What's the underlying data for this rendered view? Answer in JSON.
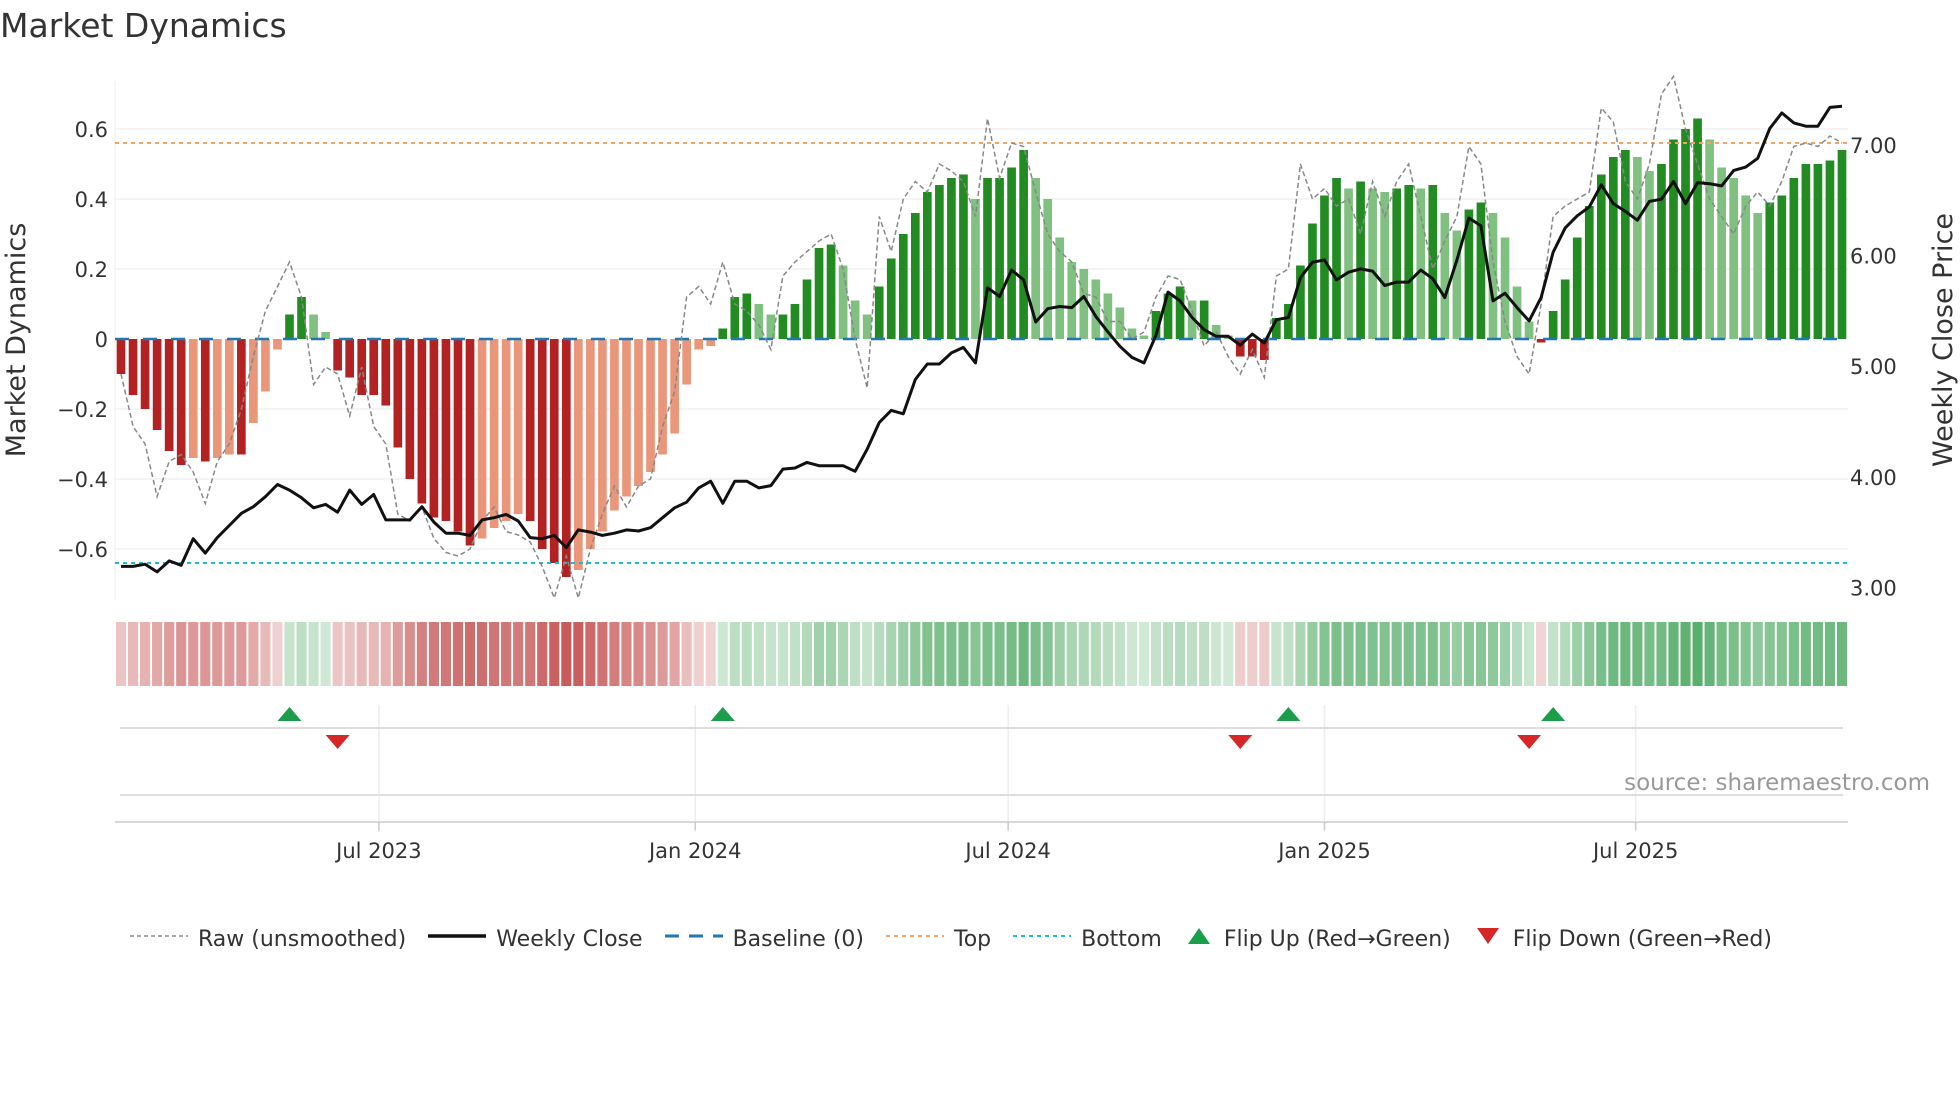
{
  "title": "Market Dynamics",
  "source": "source: sharemaestro.com",
  "chart_data": {
    "type": "bar",
    "title": "Market Dynamics",
    "ylabel": "Market Dynamics",
    "y2label": "Weekly Close Price",
    "start_week": "2023-02-01",
    "frequency": "weekly",
    "ylim": [
      -0.75,
      0.75
    ],
    "y2lim": [
      2.9,
      7.6
    ],
    "yticks": [
      0.6,
      0.4,
      0.2,
      0,
      -0.2,
      -0.4,
      -0.6
    ],
    "ytick_labels": [
      "0.6",
      "0.4",
      "0.2",
      "0",
      "−0.2",
      "−0.4",
      "−0.6"
    ],
    "y2ticks": [
      7,
      6,
      5,
      4,
      3
    ],
    "y2tick_labels": [
      "7.00",
      "6.00",
      "5.00",
      "4.00",
      "3.00"
    ],
    "xticks": [
      {
        "date": "2023-07-01",
        "label": "Jul 2023"
      },
      {
        "date": "2024-01-01",
        "label": "Jan 2024"
      },
      {
        "date": "2024-07-01",
        "label": "Jul 2024"
      },
      {
        "date": "2025-01-01",
        "label": "Jan 2025"
      },
      {
        "date": "2025-07-01",
        "label": "Jul 2025"
      }
    ],
    "top": 0.56,
    "bottom": -0.64,
    "baseline": 0,
    "smoothed": [
      -0.1,
      -0.16,
      -0.2,
      -0.26,
      -0.32,
      -0.36,
      -0.34,
      -0.35,
      -0.34,
      -0.33,
      -0.33,
      -0.24,
      -0.15,
      -0.03,
      0.07,
      0.12,
      0.07,
      0.02,
      -0.09,
      -0.11,
      -0.16,
      -0.16,
      -0.19,
      -0.31,
      -0.4,
      -0.47,
      -0.51,
      -0.52,
      -0.55,
      -0.59,
      -0.57,
      -0.54,
      -0.52,
      -0.5,
      -0.52,
      -0.6,
      -0.64,
      -0.68,
      -0.66,
      -0.6,
      -0.55,
      -0.49,
      -0.45,
      -0.42,
      -0.38,
      -0.33,
      -0.27,
      -0.13,
      -0.03,
      -0.02,
      0.03,
      0.12,
      0.13,
      0.1,
      0.07,
      0.07,
      0.1,
      0.17,
      0.26,
      0.27,
      0.21,
      0.11,
      0.07,
      0.15,
      0.23,
      0.3,
      0.36,
      0.42,
      0.44,
      0.46,
      0.47,
      0.4,
      0.46,
      0.46,
      0.49,
      0.54,
      0.46,
      0.4,
      0.29,
      0.22,
      0.2,
      0.17,
      0.13,
      0.09,
      0.03,
      0.01,
      0.08,
      0.13,
      0.15,
      0.11,
      0.11,
      0.04,
      0.01,
      -0.05,
      -0.05,
      -0.06,
      0.06,
      0.1,
      0.21,
      0.33,
      0.41,
      0.46,
      0.43,
      0.45,
      0.43,
      0.42,
      0.43,
      0.44,
      0.43,
      0.44,
      0.36,
      0.31,
      0.37,
      0.39,
      0.36,
      0.29,
      0.15,
      0.05,
      -0.01,
      0.08,
      0.17,
      0.29,
      0.38,
      0.47,
      0.52,
      0.54,
      0.52,
      0.48,
      0.5,
      0.57,
      0.6,
      0.63,
      0.57,
      0.49,
      0.46,
      0.41,
      0.36,
      0.39,
      0.41,
      0.46,
      0.5,
      0.5,
      0.51,
      0.54
    ],
    "raw": [
      -0.1,
      -0.25,
      -0.3,
      -0.45,
      -0.35,
      -0.33,
      -0.38,
      -0.47,
      -0.35,
      -0.3,
      -0.2,
      -0.05,
      0.08,
      0.15,
      0.22,
      0.12,
      -0.13,
      -0.08,
      -0.1,
      -0.22,
      -0.08,
      -0.25,
      -0.3,
      -0.5,
      -0.52,
      -0.48,
      -0.57,
      -0.61,
      -0.62,
      -0.6,
      -0.52,
      -0.48,
      -0.55,
      -0.56,
      -0.58,
      -0.65,
      -0.74,
      -0.62,
      -0.74,
      -0.6,
      -0.5,
      -0.42,
      -0.48,
      -0.42,
      -0.4,
      -0.25,
      -0.15,
      0.12,
      0.15,
      0.1,
      0.22,
      0.1,
      0.08,
      0.04,
      -0.03,
      0.18,
      0.22,
      0.25,
      0.28,
      0.3,
      0.2,
      0.0,
      -0.14,
      0.35,
      0.25,
      0.4,
      0.45,
      0.42,
      0.5,
      0.48,
      0.45,
      0.35,
      0.63,
      0.46,
      0.56,
      0.55,
      0.42,
      0.3,
      0.25,
      0.22,
      0.13,
      0.12,
      0.05,
      0.05,
      0.0,
      0.02,
      0.12,
      0.18,
      0.17,
      0.08,
      -0.02,
      0.02,
      -0.05,
      -0.1,
      -0.03,
      -0.11,
      0.18,
      0.2,
      0.5,
      0.4,
      0.43,
      0.38,
      0.4,
      0.3,
      0.45,
      0.35,
      0.45,
      0.5,
      0.35,
      0.2,
      0.28,
      0.35,
      0.55,
      0.5,
      0.22,
      0.05,
      -0.05,
      -0.1,
      0.1,
      0.35,
      0.38,
      0.4,
      0.42,
      0.66,
      0.62,
      0.45,
      0.4,
      0.5,
      0.7,
      0.75,
      0.6,
      0.5,
      0.4,
      0.35,
      0.3,
      0.38,
      0.42,
      0.38,
      0.45,
      0.55,
      0.56,
      0.55,
      0.58,
      0.56
    ],
    "close": [
      3.19,
      3.19,
      3.21,
      3.14,
      3.24,
      3.2,
      3.44,
      3.31,
      3.45,
      3.56,
      3.67,
      3.73,
      3.82,
      3.93,
      3.88,
      3.81,
      3.72,
      3.75,
      3.68,
      3.88,
      3.75,
      3.84,
      3.61,
      3.61,
      3.61,
      3.73,
      3.59,
      3.49,
      3.49,
      3.47,
      3.61,
      3.63,
      3.66,
      3.6,
      3.45,
      3.44,
      3.47,
      3.36,
      3.52,
      3.5,
      3.47,
      3.49,
      3.52,
      3.51,
      3.54,
      3.63,
      3.72,
      3.77,
      3.9,
      3.96,
      3.76,
      3.96,
      3.96,
      3.9,
      3.92,
      4.07,
      4.08,
      4.13,
      4.1,
      4.1,
      4.1,
      4.05,
      4.25,
      4.49,
      4.6,
      4.57,
      4.88,
      5.02,
      5.02,
      5.12,
      5.17,
      5.03,
      5.71,
      5.63,
      5.87,
      5.78,
      5.4,
      5.52,
      5.54,
      5.53,
      5.63,
      5.45,
      5.31,
      5.18,
      5.08,
      5.03,
      5.28,
      5.67,
      5.59,
      5.44,
      5.33,
      5.27,
      5.27,
      5.19,
      5.29,
      5.21,
      5.42,
      5.44,
      5.8,
      5.94,
      5.96,
      5.78,
      5.85,
      5.88,
      5.86,
      5.73,
      5.76,
      5.76,
      5.87,
      5.79,
      5.62,
      5.96,
      6.34,
      6.27,
      5.59,
      5.66,
      5.53,
      5.41,
      5.62,
      6.03,
      6.25,
      6.36,
      6.44,
      6.64,
      6.47,
      6.4,
      6.32,
      6.49,
      6.51,
      6.67,
      6.47,
      6.66,
      6.65,
      6.63,
      6.77,
      6.8,
      6.88,
      7.15,
      7.29,
      7.2,
      7.17,
      7.17,
      7.34,
      7.35
    ],
    "flip_up_weeks": [
      14,
      50,
      97,
      119
    ],
    "flip_down_weeks": [
      18,
      93,
      117
    ],
    "colors": {
      "neg_strong": "#b22222",
      "neg_weak": "#e9967a",
      "pos_strong": "#228b22",
      "pos_weak": "#80c080",
      "top": "#f4a460",
      "bottom": "#17becf",
      "baseline": "#1f77b4",
      "raw": "#888888",
      "close": "#111111",
      "flip_up": "#1a9e4a",
      "flip_down": "#d62728"
    },
    "legend": [
      {
        "key": "raw",
        "label": "Raw (unsmoothed)"
      },
      {
        "key": "close",
        "label": "Weekly Close"
      },
      {
        "key": "baseline",
        "label": "Baseline (0)"
      },
      {
        "key": "top",
        "label": "Top"
      },
      {
        "key": "bottom",
        "label": "Bottom"
      },
      {
        "key": "flip_up",
        "label": "Flip Up (Red→Green)"
      },
      {
        "key": "flip_down",
        "label": "Flip Down (Green→Red)"
      }
    ]
  }
}
